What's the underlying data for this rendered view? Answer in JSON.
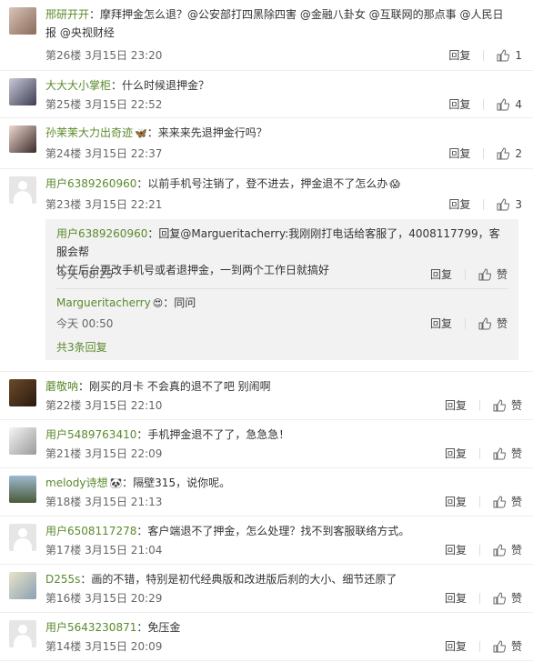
{
  "labels": {
    "reply": "回复",
    "like": "赞"
  },
  "comments": [
    {
      "user": "邢研开开",
      "text_line1": "：摩拜押金怎么退？@公安部打四黑除四害 @金融八卦女 @互联网的那点事 @人民日",
      "text_line2": "报 @央视财经",
      "floor_time": "第26楼 3月15日 23:20",
      "likes": "1"
    },
    {
      "user": "大大大小掌柜",
      "text": "：什么时候退押金？",
      "floor_time": "第25楼 3月15日 22:52",
      "likes": "4"
    },
    {
      "user": "孙茉茉大力出奇迹",
      "emoji": "🦋",
      "text": "：来来来先退押金行吗？",
      "floor_time": "第24楼 3月15日 22:37",
      "likes": "2"
    },
    {
      "user": "用户6389260960",
      "text": "：以前手机号注销了，登不进去，押金退不了怎么办",
      "emoji": "😱",
      "floor_time": "第23楼 3月15日 22:21",
      "likes": "3",
      "replies": [
        {
          "user": "用户6389260960",
          "text_line1": "：回复@Margueritacherry:我刚刚打电话给客服了，4008117799，客服会帮",
          "text_line2": "忙在后台更改手机号或者退押金，一到两个工作日就搞好",
          "time": "今天 08:25"
        },
        {
          "user": "Margueritacherry",
          "emoji": "😍",
          "text": "：同问",
          "time": "今天 00:50"
        }
      ],
      "more_replies": "共3条回复"
    },
    {
      "user": "蘑敬呐",
      "text": "：刚买的月卡 不会真的退不了吧 别闹啊",
      "floor_time": "第22楼 3月15日 22:10"
    },
    {
      "user": "用户5489763410",
      "text": "：手机押金退不了了，急急急！",
      "floor_time": "第21楼 3月15日 22:09"
    },
    {
      "user": "melody诗想",
      "emoji": "🐼",
      "text": "：隔壁315，说你呢。",
      "floor_time": "第18楼 3月15日 21:13"
    },
    {
      "user": "用户6508117278",
      "text": "：客户端退不了押金，怎么处理？找不到客服联络方式。",
      "floor_time": "第17楼 3月15日 21:04"
    },
    {
      "user": "D255s",
      "text": "：画的不错，特别是初代经典版和改进版后刹的大小、细节还原了",
      "floor_time": "第16楼 3月15日 20:29"
    },
    {
      "user": "用户5643230871",
      "text": "：免压金",
      "floor_time": "第14楼 3月15日 20:09"
    }
  ],
  "colors": {
    "username": "#5b8a2c",
    "reply_bg": "#f2f2f2",
    "divider": "#eeeeee"
  }
}
